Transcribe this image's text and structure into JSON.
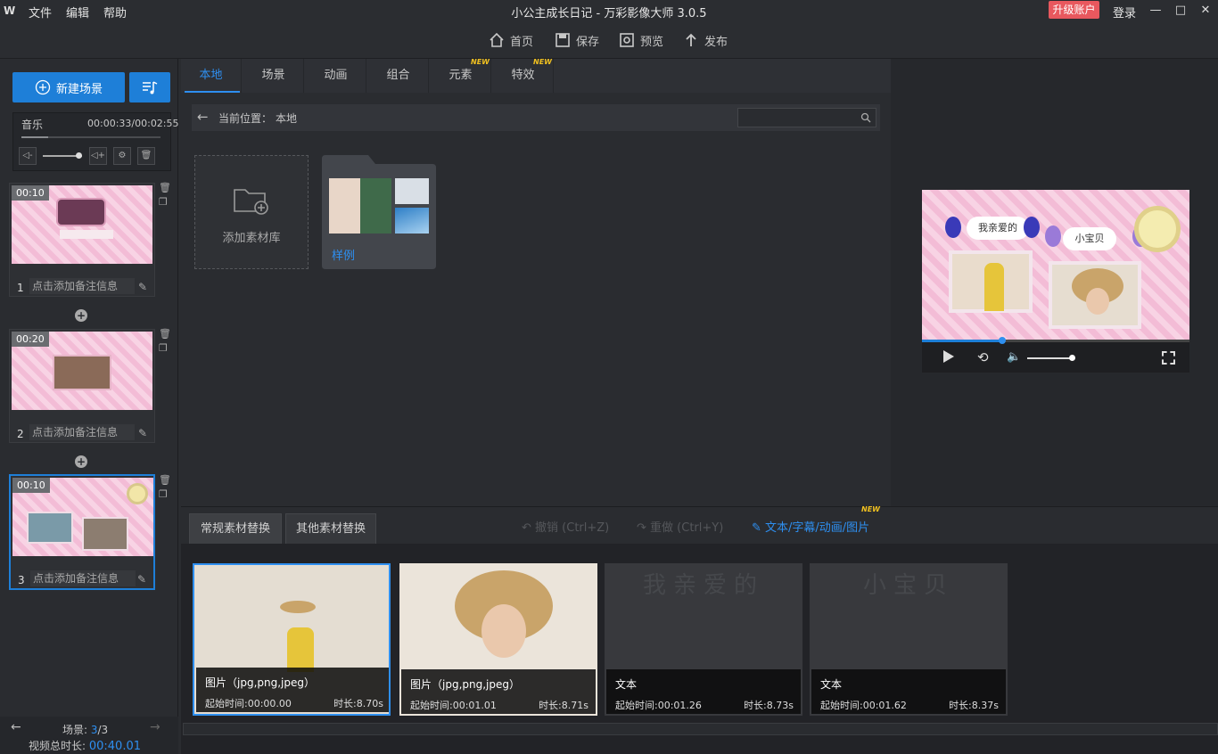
{
  "menu": {
    "logo": "W",
    "file": "文件",
    "edit": "编辑",
    "help": "帮助"
  },
  "app_title": "小公主成长日记 - 万彩影像大师 3.0.5",
  "account": {
    "upgrade": "升级账户",
    "login": "登录"
  },
  "window": {
    "min": "—",
    "max": "□",
    "close": "✕"
  },
  "toolbar": {
    "home": "首页",
    "save": "保存",
    "preview": "预览",
    "publish": "发布"
  },
  "left": {
    "new_scene": "新建场景",
    "music": {
      "label": "音乐",
      "time": "00:00:33/00:02:55",
      "progress": 0.19,
      "volume": 0.9
    },
    "scenes": [
      {
        "num": "1",
        "duration": "00:10",
        "note": "点击添加备注信息"
      },
      {
        "num": "2",
        "duration": "00:20",
        "note": "点击添加备注信息"
      },
      {
        "num": "3",
        "duration": "00:10",
        "note": "点击添加备注信息"
      }
    ],
    "footer": {
      "scene_label": "场景: ",
      "current": "3",
      "total": "/3",
      "duration_label": "视频总时长: ",
      "duration": "00:40.01"
    }
  },
  "tabs": [
    {
      "label": "本地",
      "new": ""
    },
    {
      "label": "场景",
      "new": ""
    },
    {
      "label": "动画",
      "new": ""
    },
    {
      "label": "组合",
      "new": ""
    },
    {
      "label": "元素",
      "new": "NEW"
    },
    {
      "label": "特效",
      "new": "NEW"
    }
  ],
  "pathbar": {
    "label": "当前位置：",
    "location": "本地"
  },
  "library": {
    "add": "添加素材库",
    "folder": "样例"
  },
  "preview": {
    "title1": "我亲爱的",
    "title2": "小宝贝",
    "progress": 0.3,
    "volume": 0.7
  },
  "bottom": {
    "tab_regular": "常规素材替换",
    "tab_other": "其他素材替换",
    "undo": "撤销 (Ctrl+Z)",
    "redo": "重做 (Ctrl+Y)",
    "replace": "文本/字幕/动画/图片",
    "replace_new": "NEW",
    "cards": [
      {
        "type": "图片（jpg,png,jpeg）",
        "start": "起始时间:00:00.00",
        "duration": "时长:8.70s",
        "ghost": ""
      },
      {
        "type": "图片（jpg,png,jpeg）",
        "start": "起始时间:00:01.01",
        "duration": "时长:8.71s",
        "ghost": ""
      },
      {
        "type": "文本",
        "start": "起始时间:00:01.26",
        "duration": "时长:8.73s",
        "ghost": "我亲爱的"
      },
      {
        "type": "文本",
        "start": "起始时间:00:01.62",
        "duration": "时长:8.37s",
        "ghost": "小宝贝"
      }
    ]
  },
  "colors": {
    "accent": "#1e7fd8",
    "upgrade": "#e8585e",
    "new_tag": "#f0c020"
  }
}
